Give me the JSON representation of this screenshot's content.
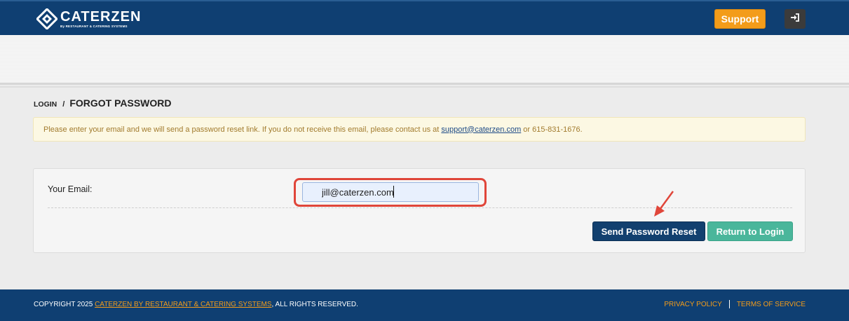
{
  "header": {
    "logo_name": "CATERZEN",
    "logo_sub": "By RESTAURANT & CATERING SYSTEMS",
    "support_label": "Support",
    "login_icon": "sign-in-icon"
  },
  "breadcrumb": {
    "parent": "LOGIN",
    "separator": "/",
    "current": "FORGOT PASSWORD"
  },
  "notice": {
    "text_before": "Please enter your email and we will send a password reset link. If you do not receive this email, please contact us at",
    "email_link": "support@caterzen.com",
    "text_after": "or 615-831-1676."
  },
  "form": {
    "email_label": "Your Email:",
    "email_value": "jill@caterzen.com",
    "send_label": "Send Password Reset",
    "return_label": "Return to Login"
  },
  "footer": {
    "copyright_prefix": "COPYRIGHT 2025",
    "company_link": "CATERZEN BY RESTAURANT & CATERING SYSTEMS",
    "copyright_suffix": ", ALL RIGHTS RESERVED.",
    "privacy": "PRIVACY POLICY",
    "terms": "TERMS OF SERVICE"
  },
  "colors": {
    "brand_navy": "#0f3f72",
    "accent_orange": "#f39c1a",
    "teal": "#4ab69b",
    "highlight_red": "#e0463a"
  }
}
